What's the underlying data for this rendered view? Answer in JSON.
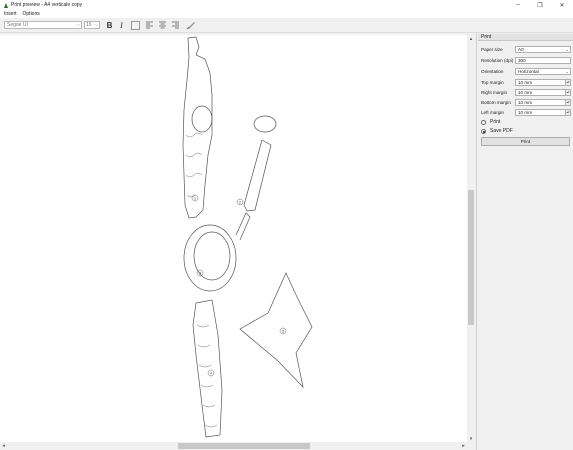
{
  "window": {
    "title": "Print preview - A4 verticale copy",
    "controls": {
      "minimize": "–",
      "maximize": "❒",
      "close": "✕"
    }
  },
  "menu": [
    "Insert",
    "Options"
  ],
  "toolbar": {
    "font_value": "Segoe UI",
    "size_value": "16",
    "bold_label": "B",
    "italic_label": "I",
    "icons": [
      "color-swatch-icon",
      "align-left-icon",
      "align-center-icon",
      "align-right-icon",
      "brush-icon"
    ]
  },
  "panel": {
    "header": "Print",
    "paper_size": {
      "label": "Paper size",
      "value": "A0"
    },
    "resolution": {
      "label": "Resolution (dpi)",
      "value": "300"
    },
    "orientation": {
      "label": "Orientation",
      "value": "Horizontal"
    },
    "top_margin": {
      "label": "Top margin",
      "value": "10 mm"
    },
    "right_margin": {
      "label": "Right margin",
      "value": "10 mm"
    },
    "bottom_margin": {
      "label": "Bottom margin",
      "value": "10 mm"
    },
    "left_margin": {
      "label": "Left margin",
      "value": "10 mm"
    },
    "output_print": "Print",
    "output_pdf": "Save PDF",
    "output_selected": "Save PDF",
    "print_button": "Print"
  },
  "preview": {
    "figure_numbers": [
      "1",
      "2",
      "3",
      "4",
      "5"
    ]
  }
}
